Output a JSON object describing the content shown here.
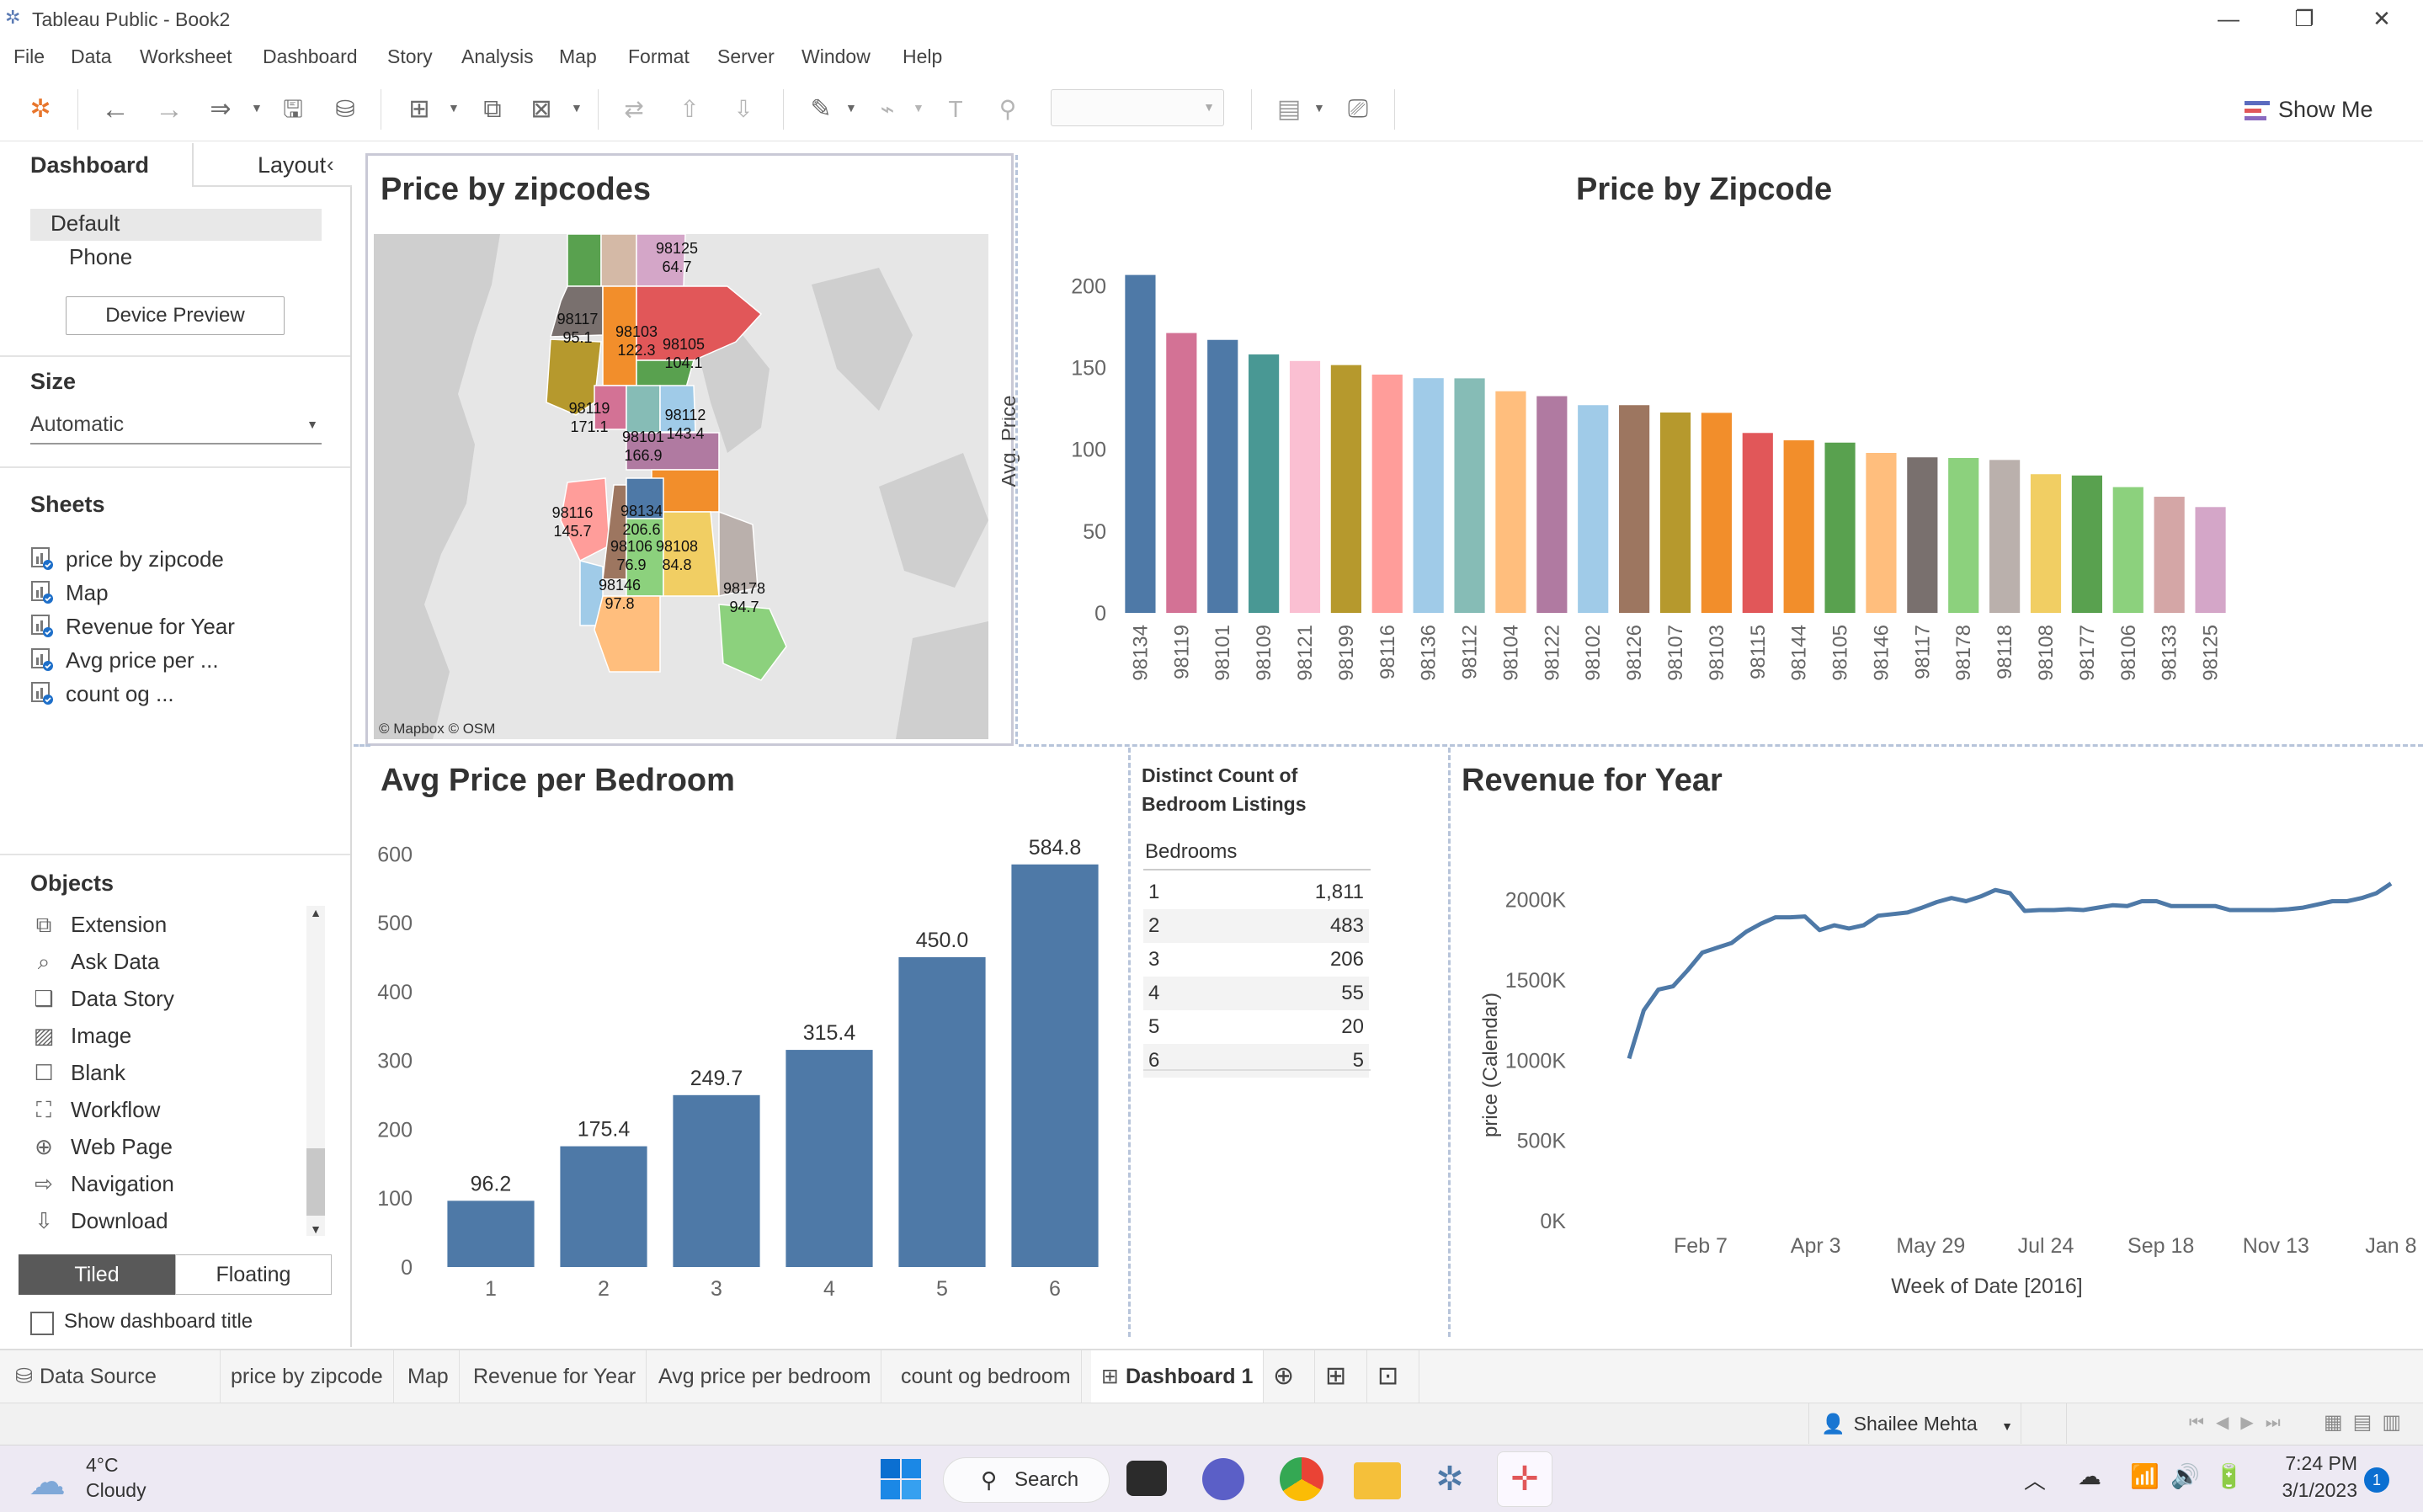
{
  "window": {
    "title": "Tableau Public - Book2"
  },
  "menu": [
    "File",
    "Data",
    "Worksheet",
    "Dashboard",
    "Story",
    "Analysis",
    "Map",
    "Format",
    "Server",
    "Window",
    "Help"
  ],
  "toolbar": {
    "show_me": "Show Me"
  },
  "left_panel": {
    "tab_dashboard": "Dashboard",
    "tab_layout": "Layout",
    "devices": [
      "Default",
      "Phone"
    ],
    "device_preview": "Device Preview",
    "size_title": "Size",
    "size_value": "Automatic",
    "sheets_title": "Sheets",
    "sheets": [
      "price by zipcode",
      "Map",
      "Revenue for Year",
      "Avg price per ...",
      "count og ..."
    ],
    "objects_title": "Objects",
    "objects": [
      {
        "label": "Extension",
        "icon": "puzzle-icon"
      },
      {
        "label": "Ask Data",
        "icon": "ask-data-icon"
      },
      {
        "label": "Data Story",
        "icon": "book-icon"
      },
      {
        "label": "Image",
        "icon": "image-icon"
      },
      {
        "label": "Blank",
        "icon": "blank-icon"
      },
      {
        "label": "Workflow",
        "icon": "workflow-icon"
      },
      {
        "label": "Web Page",
        "icon": "globe-icon"
      },
      {
        "label": "Navigation",
        "icon": "navigation-icon"
      },
      {
        "label": "Download",
        "icon": "download-icon"
      }
    ],
    "tiled": "Tiled",
    "floating": "Floating",
    "show_title": "Show dashboard title"
  },
  "map": {
    "title": "Price by zipcodes",
    "attribution": "© Mapbox © OSM",
    "labels": [
      {
        "zip": "98125",
        "value": "64.7"
      },
      {
        "zip": "98117",
        "value": "95.1"
      },
      {
        "zip": "98103",
        "value": "122.3"
      },
      {
        "zip": "98105",
        "value": "104.1"
      },
      {
        "zip": "98119",
        "value": "171.1"
      },
      {
        "zip": "98112",
        "value": "143.4"
      },
      {
        "zip": "98101",
        "value": "166.9"
      },
      {
        "zip": "98116",
        "value": "145.7"
      },
      {
        "zip": "98134",
        "value": "206.6"
      },
      {
        "zip": "98106",
        "value": "76.9"
      },
      {
        "zip": "98108",
        "value": "84.8"
      },
      {
        "zip": "98146",
        "value": "97.8"
      },
      {
        "zip": "98178",
        "value": "94.7"
      }
    ]
  },
  "chart_data": [
    {
      "type": "bar",
      "title": "Price by Zipcode",
      "ylabel": "Avg. Price",
      "ylim": [
        0,
        210
      ],
      "yticks": [
        0,
        50,
        100,
        150,
        200
      ],
      "categories": [
        "98134",
        "98119",
        "98101",
        "98109",
        "98121",
        "98199",
        "98116",
        "98136",
        "98112",
        "98104",
        "98122",
        "98102",
        "98126",
        "98107",
        "98103",
        "98115",
        "98144",
        "98105",
        "98146",
        "98117",
        "98178",
        "98118",
        "98108",
        "98177",
        "98106",
        "98133",
        "98125"
      ],
      "values": [
        206.6,
        171.1,
        166.9,
        158.0,
        154.0,
        151.5,
        145.7,
        143.5,
        143.4,
        135.5,
        132.5,
        127.0,
        127.0,
        122.5,
        122.3,
        110.0,
        105.5,
        104.1,
        97.8,
        95.1,
        94.7,
        93.5,
        84.8,
        84.0,
        76.9,
        71.0,
        64.7
      ],
      "colors": [
        "#4e79a7",
        "#d37295",
        "#4e79a7",
        "#499894",
        "#fabfd2",
        "#b6992d",
        "#ff9d9a",
        "#a0cbe8",
        "#86bcb6",
        "#ffbe7d",
        "#b07aa1",
        "#a0cbe8",
        "#9d7660",
        "#b6992d",
        "#f28e2b",
        "#e15759",
        "#f28e2b",
        "#59a14f",
        "#ffbe7d",
        "#79706e",
        "#8cd17d",
        "#bab0ac",
        "#f1ce63",
        "#59a14f",
        "#8cd17d",
        "#d4a6a6",
        "#d4a6c8"
      ],
      "grid": false
    },
    {
      "type": "bar",
      "title": "Avg Price per Bedroom",
      "categories": [
        "1",
        "2",
        "3",
        "4",
        "5",
        "6"
      ],
      "values": [
        96.2,
        175.4,
        249.7,
        315.4,
        450.0,
        584.8
      ],
      "labels": [
        "96.2",
        "175.4",
        "249.7",
        "315.4",
        "450.0",
        "584.8"
      ],
      "ylim": [
        0,
        620
      ],
      "yticks": [
        0,
        100,
        200,
        300,
        400,
        500,
        600
      ],
      "color": "#4e79a7",
      "grid": false
    },
    {
      "type": "table",
      "title": "Distinct Count of Bedroom Listings",
      "column": "Bedrooms",
      "rows": [
        {
          "key": "1",
          "value": "1,811"
        },
        {
          "key": "2",
          "value": "483"
        },
        {
          "key": "3",
          "value": "206"
        },
        {
          "key": "4",
          "value": "55"
        },
        {
          "key": "5",
          "value": "20"
        },
        {
          "key": "6",
          "value": "5"
        }
      ]
    },
    {
      "type": "line",
      "title": "Revenue for Year",
      "xlabel": "Week of Date [2016]",
      "ylabel": "price (Calendar)",
      "ylim": [
        0,
        2150
      ],
      "yticks": [
        "0K",
        "500K",
        "1000K",
        "1500K",
        "2000K"
      ],
      "xticks": [
        "Feb 7",
        "Apr 3",
        "May 29",
        "Jul 24",
        "Sep 18",
        "Nov 13",
        "Jan 8"
      ],
      "x": [
        1,
        2,
        3,
        4,
        5,
        6,
        7,
        8,
        9,
        10,
        11,
        12,
        13,
        14,
        15,
        16,
        17,
        18,
        19,
        20,
        21,
        22,
        23,
        24,
        25,
        26,
        27,
        28,
        29,
        30,
        31,
        32,
        33,
        34,
        35,
        36,
        37,
        38,
        39,
        40,
        41,
        42,
        43,
        44,
        45,
        46,
        47,
        48,
        49,
        50,
        51,
        52,
        53
      ],
      "values": [
        1010,
        1310,
        1440,
        1460,
        1560,
        1670,
        1700,
        1730,
        1800,
        1850,
        1890,
        1890,
        1895,
        1810,
        1840,
        1820,
        1840,
        1900,
        1910,
        1920,
        1950,
        1985,
        2010,
        1990,
        2020,
        2060,
        2040,
        1930,
        1935,
        1935,
        1940,
        1935,
        1950,
        1965,
        1960,
        1990,
        1990,
        1960,
        1960,
        1960,
        1960,
        1935,
        1935,
        1935,
        1935,
        1940,
        1950,
        1970,
        1990,
        1990,
        2010,
        2040,
        2100
      ],
      "color": "#4e79a7",
      "grid": false
    }
  ],
  "bottom_tabs": [
    "Data Source",
    "price by zipcode",
    "Map",
    "Revenue for Year",
    "Avg price per bedroom",
    "count og bedroom",
    "Dashboard 1"
  ],
  "status": {
    "user": "Shailee Mehta"
  },
  "taskbar": {
    "weather_temp": "4°C",
    "weather_desc": "Cloudy",
    "search": "Search",
    "time": "7:24 PM",
    "date": "3/1/2023",
    "notifications": "1"
  }
}
